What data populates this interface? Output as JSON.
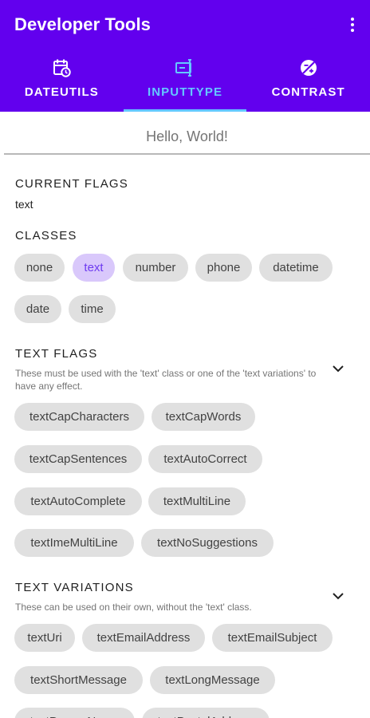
{
  "app": {
    "title": "Developer Tools"
  },
  "colors": {
    "primary": "#6200ee",
    "accent": "#64c8ff",
    "chip": "#e0e0e0",
    "chip_selected": "#d9c8fb"
  },
  "tabs": [
    {
      "label": "DATEUTILS",
      "icon": "calendar-clock-icon",
      "active": false
    },
    {
      "label": "INPUTTYPE",
      "icon": "text-cursor-icon",
      "active": true
    },
    {
      "label": "CONTRAST",
      "icon": "contrast-icon",
      "active": false
    }
  ],
  "input": {
    "value": "",
    "placeholder": "Hello, World!"
  },
  "current_flags": {
    "title": "CURRENT FLAGS",
    "value": "text"
  },
  "classes": {
    "title": "CLASSES",
    "chips": [
      "none",
      "text",
      "number",
      "phone",
      "datetime",
      "date",
      "time"
    ],
    "selected": "text"
  },
  "text_flags": {
    "title": "TEXT FLAGS",
    "subtitle": "These must be used with the 'text' class or one of the 'text variations' to have any effect.",
    "chips": [
      "textCapCharacters",
      "textCapWords",
      "textCapSentences",
      "textAutoCorrect",
      "textAutoComplete",
      "textMultiLine",
      "textImeMultiLine",
      "textNoSuggestions"
    ]
  },
  "text_variations": {
    "title": "TEXT VARIATIONS",
    "subtitle": "These can be used on their own, without the 'text' class.",
    "chips": [
      "textUri",
      "textEmailAddress",
      "textEmailSubject",
      "textShortMessage",
      "textLongMessage",
      "textPersonName",
      "textPostalAddress"
    ]
  }
}
